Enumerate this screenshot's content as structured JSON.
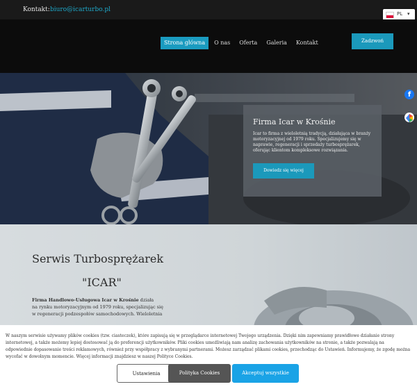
{
  "topbar": {
    "contact_label": "Kontakt:",
    "contact_email": "biuro@icarturbo.pl",
    "language": {
      "code": "PL",
      "caret": "▾",
      "flag": "flag-poland-icon"
    }
  },
  "nav": {
    "items": [
      {
        "label": "Strona główna",
        "active": true
      },
      {
        "label": "O nas",
        "active": false
      },
      {
        "label": "Oferta",
        "active": false
      },
      {
        "label": "Galeria",
        "active": false
      },
      {
        "label": "Kontakt",
        "active": false
      }
    ],
    "order_button": "Zadzwoń"
  },
  "hero": {
    "card_title": "Firma Icar w Krośnie",
    "card_text": "Icar to firma z wieloletnią tradycją, działająca w branży motoryzacyjnej od 1979 roku. Specjalizujemy się w naprawie, regeneracji i sprzedaży turbosprężarek, oferując klientom kompleksowe rozwiązania.",
    "more_button": "Dowiedz się więcej",
    "social": [
      {
        "name": "facebook-icon",
        "glyph": "f"
      },
      {
        "name": "google-icon"
      }
    ],
    "slider": {
      "total": 2,
      "active": 1
    },
    "colors": {
      "accent": "#1b99bb",
      "dot_active": "#1a9bc0",
      "dot_inactive": "#333333"
    }
  },
  "section": {
    "title_line1": "Serwis Turbosprężarek",
    "title_line2": "\"ICAR\"",
    "company_name": "Firma Handlowo-Usługowa Icar w Krośnie",
    "company_text_1": " działa",
    "company_text_2": "na rynku motoryzacyjnym od 1979 roku, specjalizując się",
    "company_text_3": "w regeneracji podzespołów samochodowych. Wieloletnia"
  },
  "cookie": {
    "text": "W naszym serwisie używamy plików cookies (tzw. ciasteczek), które zapisują się w przeglądarce internetowej Twojego urządzenia. Dzięki nim zapewniamy prawidłowe działanie strony internetowej, a także możemy lepiej dostosować ją do preferencji użytkowników. Pliki cookies umożliwiają nam analizę zachowania użytkowników na stronie, a także pozwalają na odpowiednie dopasowanie treści reklamowych, również przy współpracy z wybranymi partnerami. Możesz zarządzać plikami cookies, przechodząc do Ustawień. Informujemy, że zgodę można wycofać w dowolnym momencie. Więcej informacji znajdziesz w naszej Polityce Cookies.",
    "settings_button": "Ustawienia",
    "policy_button": "Polityka Cookies",
    "accept_button": "Akceptuj wszystkie"
  }
}
